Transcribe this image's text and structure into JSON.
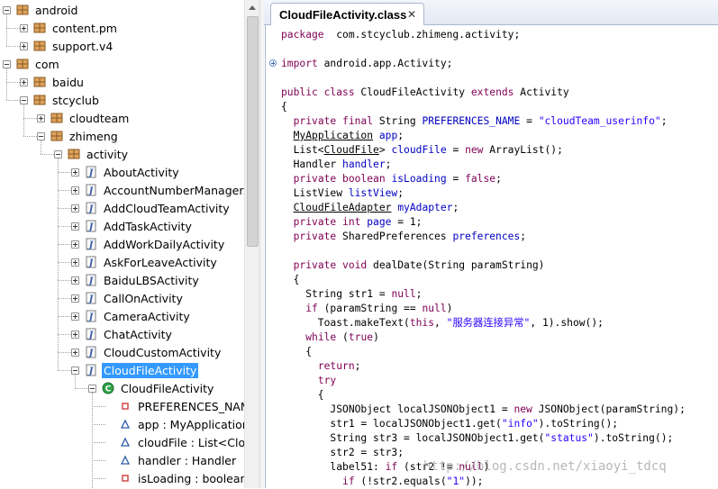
{
  "tree": {
    "items": [
      {
        "label": "android",
        "level": 0,
        "toggle": "minus",
        "icon": "package-icon"
      },
      {
        "label": "content.pm",
        "level": 1,
        "toggle": "plus",
        "icon": "package-icon"
      },
      {
        "label": "support.v4",
        "level": 1,
        "toggle": "plus",
        "icon": "package-icon"
      },
      {
        "label": "com",
        "level": 0,
        "toggle": "minus",
        "icon": "package-icon"
      },
      {
        "label": "baidu",
        "level": 1,
        "toggle": "plus",
        "icon": "package-icon"
      },
      {
        "label": "stcyclub",
        "level": 1,
        "toggle": "minus",
        "icon": "package-icon"
      },
      {
        "label": "cloudteam",
        "level": 2,
        "toggle": "plus",
        "icon": "package-icon"
      },
      {
        "label": "zhimeng",
        "level": 2,
        "toggle": "minus",
        "icon": "package-icon"
      },
      {
        "label": "activity",
        "level": 3,
        "toggle": "minus",
        "icon": "package-icon"
      },
      {
        "label": "AboutActivity",
        "level": 4,
        "toggle": "plus",
        "icon": "java-file-icon"
      },
      {
        "label": "AccountNumberManagerActivity",
        "level": 4,
        "toggle": "plus",
        "icon": "java-file-icon"
      },
      {
        "label": "AddCloudTeamActivity",
        "level": 4,
        "toggle": "plus",
        "icon": "java-file-icon"
      },
      {
        "label": "AddTaskActivity",
        "level": 4,
        "toggle": "plus",
        "icon": "java-file-icon"
      },
      {
        "label": "AddWorkDailyActivity",
        "level": 4,
        "toggle": "plus",
        "icon": "java-file-icon"
      },
      {
        "label": "AskForLeaveActivity",
        "level": 4,
        "toggle": "plus",
        "icon": "java-file-icon"
      },
      {
        "label": "BaiduLBSActivity",
        "level": 4,
        "toggle": "plus",
        "icon": "java-file-icon"
      },
      {
        "label": "CallOnActivity",
        "level": 4,
        "toggle": "plus",
        "icon": "java-file-icon"
      },
      {
        "label": "CameraActivity",
        "level": 4,
        "toggle": "plus",
        "icon": "java-file-icon"
      },
      {
        "label": "ChatActivity",
        "level": 4,
        "toggle": "plus",
        "icon": "java-file-icon"
      },
      {
        "label": "CloudCustomActivity",
        "level": 4,
        "toggle": "plus",
        "icon": "java-file-icon"
      },
      {
        "label": "CloudFileActivity",
        "level": 4,
        "toggle": "minus",
        "icon": "java-file-icon",
        "selected": true
      },
      {
        "label": "CloudFileActivity",
        "level": 5,
        "toggle": "minus",
        "icon": "class-icon"
      },
      {
        "label": "PREFERENCES_NAME : String",
        "level": 6,
        "toggle": "none",
        "icon": "private-field-icon"
      },
      {
        "label": "app : MyApplication",
        "level": 6,
        "toggle": "none",
        "icon": "default-field-icon"
      },
      {
        "label": "cloudFile : List<CloudFile>",
        "level": 6,
        "toggle": "none",
        "icon": "default-field-icon"
      },
      {
        "label": "handler : Handler",
        "level": 6,
        "toggle": "none",
        "icon": "default-field-icon"
      },
      {
        "label": "isLoading : boolean",
        "level": 6,
        "toggle": "none",
        "icon": "private-field-icon"
      }
    ]
  },
  "editor": {
    "tab_title": "CloudFileActivity.class",
    "tab_close": "✕",
    "lines": [
      [
        [
          "kw",
          "package"
        ],
        [
          "",
          "  com.stcyclub.zhimeng.activity;"
        ]
      ],
      [],
      [
        [
          "kw",
          "import"
        ],
        [
          "",
          " android.app.Activity;"
        ]
      ],
      [],
      [
        [
          "kw",
          "public class"
        ],
        [
          "",
          " CloudFileActivity "
        ],
        [
          "kw",
          "extends"
        ],
        [
          "",
          " Activity"
        ]
      ],
      [
        [
          "",
          "{"
        ]
      ],
      [
        [
          "",
          "  "
        ],
        [
          "kw",
          "private final"
        ],
        [
          "",
          " String "
        ],
        [
          "fd",
          "PREFERENCES_NAME"
        ],
        [
          "",
          " = "
        ],
        [
          "st",
          "\"cloudTeam_userinfo\""
        ],
        [
          "",
          ";"
        ]
      ],
      [
        [
          "",
          "  "
        ],
        [
          "ul",
          "MyApplication"
        ],
        [
          "",
          " "
        ],
        [
          "fd",
          "app"
        ],
        [
          "",
          ";"
        ]
      ],
      [
        [
          "",
          "  List<"
        ],
        [
          "ul",
          "CloudFile"
        ],
        [
          "",
          "> "
        ],
        [
          "fd",
          "cloudFile"
        ],
        [
          "",
          " = "
        ],
        [
          "kw",
          "new"
        ],
        [
          "",
          " ArrayList();"
        ]
      ],
      [
        [
          "",
          "  Handler "
        ],
        [
          "fd",
          "handler"
        ],
        [
          "",
          ";"
        ]
      ],
      [
        [
          "",
          "  "
        ],
        [
          "kw",
          "private boolean"
        ],
        [
          "",
          " "
        ],
        [
          "fd",
          "isLoading"
        ],
        [
          "",
          " = "
        ],
        [
          "kw",
          "false"
        ],
        [
          "",
          ";"
        ]
      ],
      [
        [
          "",
          "  ListView "
        ],
        [
          "fd",
          "listView"
        ],
        [
          "",
          ";"
        ]
      ],
      [
        [
          "",
          "  "
        ],
        [
          "ul",
          "CloudFileAdapter"
        ],
        [
          "",
          " "
        ],
        [
          "fd",
          "myAdapter"
        ],
        [
          "",
          ";"
        ]
      ],
      [
        [
          "",
          "  "
        ],
        [
          "kw",
          "private int"
        ],
        [
          "",
          " "
        ],
        [
          "fd",
          "page"
        ],
        [
          "",
          " = 1;"
        ]
      ],
      [
        [
          "",
          "  "
        ],
        [
          "kw",
          "private"
        ],
        [
          "",
          " SharedPreferences "
        ],
        [
          "fd",
          "preferences"
        ],
        [
          "",
          ";"
        ]
      ],
      [],
      [
        [
          "",
          "  "
        ],
        [
          "kw",
          "private void"
        ],
        [
          "",
          " dealDate(String paramString)"
        ]
      ],
      [
        [
          "",
          "  {"
        ]
      ],
      [
        [
          "",
          "    String str1 = "
        ],
        [
          "kw",
          "null"
        ],
        [
          "",
          ";"
        ]
      ],
      [
        [
          "",
          "    "
        ],
        [
          "kw",
          "if"
        ],
        [
          "",
          " (paramString == "
        ],
        [
          "kw",
          "null"
        ],
        [
          "",
          ")"
        ]
      ],
      [
        [
          "",
          "      Toast.makeText("
        ],
        [
          "kw",
          "this"
        ],
        [
          "",
          ", "
        ],
        [
          "st",
          "\"服务器连接异常\""
        ],
        [
          "",
          ", 1).show();"
        ]
      ],
      [
        [
          "",
          "    "
        ],
        [
          "kw",
          "while"
        ],
        [
          "",
          " ("
        ],
        [
          "kw",
          "true"
        ],
        [
          "",
          ")"
        ]
      ],
      [
        [
          "",
          "    {"
        ]
      ],
      [
        [
          "",
          "      "
        ],
        [
          "kw",
          "return"
        ],
        [
          "",
          ";"
        ]
      ],
      [
        [
          "",
          "      "
        ],
        [
          "kw",
          "try"
        ]
      ],
      [
        [
          "",
          "      {"
        ]
      ],
      [
        [
          "",
          "        JSONObject localJSONObject1 = "
        ],
        [
          "kw",
          "new"
        ],
        [
          "",
          " JSONObject(paramString);"
        ]
      ],
      [
        [
          "",
          "        str1 = localJSONObject1.get("
        ],
        [
          "st",
          "\"info\""
        ],
        [
          "",
          ").toString();"
        ]
      ],
      [
        [
          "",
          "        String str3 = localJSONObject1.get("
        ],
        [
          "st",
          "\"status\""
        ],
        [
          "",
          ").toString();"
        ]
      ],
      [
        [
          "",
          "        str2 = str3;"
        ]
      ],
      [
        [
          "",
          "        label51: "
        ],
        [
          "kw",
          "if"
        ],
        [
          "",
          " (str2 != "
        ],
        [
          "kw",
          "null"
        ],
        [
          "",
          ")"
        ]
      ],
      [
        [
          "",
          "          "
        ],
        [
          "kw",
          "if"
        ],
        [
          "",
          " (!str2.equals("
        ],
        [
          "st",
          "\"1\""
        ],
        [
          "",
          "));"
        ]
      ]
    ]
  },
  "watermark": "http://blog.csdn.net/xiaoyi_tdcq"
}
